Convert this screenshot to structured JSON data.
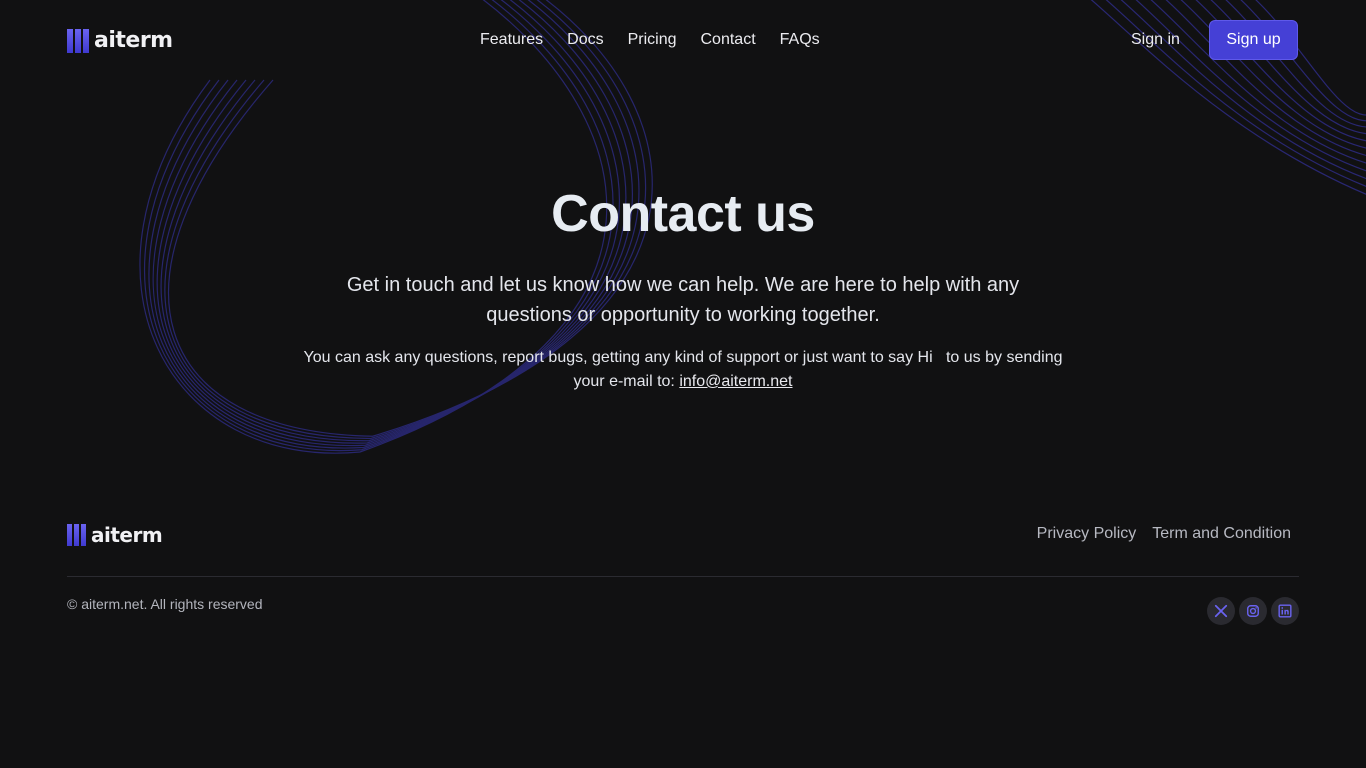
{
  "brand": {
    "name": "aiterm"
  },
  "header": {
    "nav": [
      {
        "label": "Features"
      },
      {
        "label": "Docs"
      },
      {
        "label": "Pricing"
      },
      {
        "label": "Contact"
      },
      {
        "label": "FAQs"
      }
    ],
    "signin_label": "Sign in",
    "signup_label": "Sign up"
  },
  "hero": {
    "title": "Contact us",
    "subtitle": "Get in touch and let us know how we can help. We are here to help with any questions or opportunity to working together.",
    "note_text": "You can ask any questions, report bugs, getting any kind of support or just want to say Hi   to us by sending your e-mail to: ",
    "email": "info@aiterm.net"
  },
  "footer": {
    "links": [
      {
        "label": "Privacy Policy"
      },
      {
        "label": "Term and Condition"
      }
    ],
    "copyright": "© aiterm.net. All rights reserved",
    "socials": [
      {
        "icon": "x-icon"
      },
      {
        "icon": "instagram-icon"
      },
      {
        "icon": "linkedin-icon"
      }
    ]
  },
  "colors": {
    "background": "#111112",
    "accent": "#4540d6",
    "accent_light": "#6a63f0",
    "text": "#e6e6ea",
    "muted_text": "#b7b9c2"
  }
}
